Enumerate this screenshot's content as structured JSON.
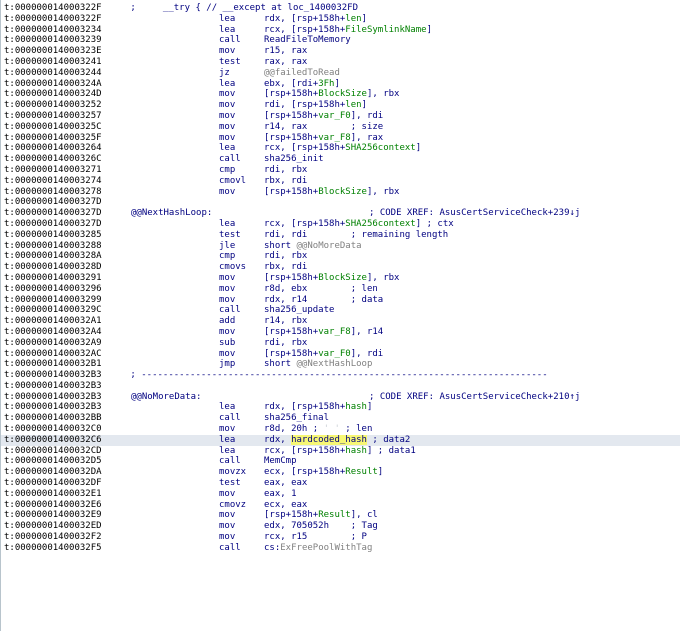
{
  "rows": [
    {
      "addr": "t:000000014000322F",
      "parts": [
        {
          "t": " ;     __try { // __except at loc_1400032FD",
          "k": "cm"
        }
      ],
      "full": true
    },
    {
      "addr": "t:000000014000322F",
      "mn": "lea",
      "ops": [
        {
          "t": "rdx, [rsp+158h+"
        },
        {
          "t": "len",
          "k": "gr"
        },
        {
          "t": "]"
        }
      ]
    },
    {
      "addr": "t:0000000140003234",
      "mn": "lea",
      "ops": [
        {
          "t": "rcx, [rsp+158h+"
        },
        {
          "t": "FileSymlinkName",
          "k": "gr"
        },
        {
          "t": "]"
        }
      ]
    },
    {
      "addr": "t:0000000140003239",
      "mn": "call",
      "ops": [
        {
          "t": "ReadFileToMemory"
        }
      ]
    },
    {
      "addr": "t:000000014000323E",
      "mn": "mov",
      "ops": [
        {
          "t": "r15, rax"
        }
      ]
    },
    {
      "addr": "t:0000000140003241",
      "mn": "test",
      "ops": [
        {
          "t": "rax, rax"
        }
      ]
    },
    {
      "addr": "t:0000000140003244",
      "mn": "jz",
      "ops": [
        {
          "t": "@@failedToRead",
          "k": "gy"
        }
      ]
    },
    {
      "addr": "t:000000014000324A",
      "mn": "lea",
      "ops": [
        {
          "t": "ebx, [rdi+"
        },
        {
          "t": "3Fh",
          "k": "gr"
        },
        {
          "t": "]"
        }
      ]
    },
    {
      "addr": "t:000000014000324D",
      "mn": "mov",
      "ops": [
        {
          "t": "[rsp+158h+"
        },
        {
          "t": "BlockSize",
          "k": "gr"
        },
        {
          "t": "], rbx"
        }
      ]
    },
    {
      "addr": "t:0000000140003252",
      "mn": "mov",
      "ops": [
        {
          "t": "rdi, [rsp+158h+"
        },
        {
          "t": "len",
          "k": "gr"
        },
        {
          "t": "]"
        }
      ]
    },
    {
      "addr": "t:0000000140003257",
      "mn": "mov",
      "ops": [
        {
          "t": "[rsp+158h+"
        },
        {
          "t": "var_F0",
          "k": "gr"
        },
        {
          "t": "], rdi"
        }
      ]
    },
    {
      "addr": "t:000000014000325C",
      "mn": "mov",
      "ops": [
        {
          "t": "r14, rax        ; size"
        }
      ]
    },
    {
      "addr": "t:000000014000325F",
      "mn": "mov",
      "ops": [
        {
          "t": "[rsp+158h+"
        },
        {
          "t": "var_F8",
          "k": "gr"
        },
        {
          "t": "], rax"
        }
      ]
    },
    {
      "addr": "t:0000000140003264",
      "mn": "lea",
      "ops": [
        {
          "t": "rcx, [rsp+158h+"
        },
        {
          "t": "SHA256context",
          "k": "gr"
        },
        {
          "t": "]"
        }
      ]
    },
    {
      "addr": "t:000000014000326C",
      "mn": "call",
      "ops": [
        {
          "t": "sha256_init"
        }
      ]
    },
    {
      "addr": "t:0000000140003271",
      "mn": "cmp",
      "ops": [
        {
          "t": "rdi, rbx"
        }
      ]
    },
    {
      "addr": "t:0000000140003274",
      "mn": "cmovl",
      "ops": [
        {
          "t": "rbx, rdi"
        }
      ]
    },
    {
      "addr": "t:0000000140003278",
      "mn": "mov",
      "ops": [
        {
          "t": "[rsp+158h+"
        },
        {
          "t": "BlockSize",
          "k": "gr"
        },
        {
          "t": "], rbx"
        }
      ]
    },
    {
      "addr": "t:000000014000327D"
    },
    {
      "addr": "t:000000014000327D",
      "label": "@@NextHashLoop:",
      "comment": "; CODE XREF: AsusCertServiceCheck+239↓j"
    },
    {
      "addr": "t:000000014000327D",
      "mn": "lea",
      "ops": [
        {
          "t": "rcx, [rsp+158h+"
        },
        {
          "t": "SHA256context",
          "k": "gr"
        },
        {
          "t": "] ; ctx"
        }
      ]
    },
    {
      "addr": "t:0000000140003285",
      "mn": "test",
      "ops": [
        {
          "t": "rdi, rdi        ; remaining length"
        }
      ]
    },
    {
      "addr": "t:0000000140003288",
      "mn": "jle",
      "ops": [
        {
          "t": "short "
        },
        {
          "t": "@@NoMoreData",
          "k": "gy"
        }
      ]
    },
    {
      "addr": "t:000000014000328A",
      "mn": "cmp",
      "ops": [
        {
          "t": "rdi, rbx"
        }
      ]
    },
    {
      "addr": "t:000000014000328D",
      "mn": "cmovs",
      "ops": [
        {
          "t": "rbx, rdi"
        }
      ]
    },
    {
      "addr": "t:0000000140003291",
      "mn": "mov",
      "ops": [
        {
          "t": "[rsp+158h+"
        },
        {
          "t": "BlockSize",
          "k": "gr"
        },
        {
          "t": "], rbx"
        }
      ]
    },
    {
      "addr": "t:0000000140003296",
      "mn": "mov",
      "ops": [
        {
          "t": "r8d, ebx        ; len"
        }
      ]
    },
    {
      "addr": "t:0000000140003299",
      "mn": "mov",
      "ops": [
        {
          "t": "rdx, r14        ; data"
        }
      ]
    },
    {
      "addr": "t:000000014000329C",
      "mn": "call",
      "ops": [
        {
          "t": "sha256_update"
        }
      ]
    },
    {
      "addr": "t:00000001400032A1",
      "mn": "add",
      "ops": [
        {
          "t": "r14, rbx"
        }
      ]
    },
    {
      "addr": "t:00000001400032A4",
      "mn": "mov",
      "ops": [
        {
          "t": "[rsp+158h+"
        },
        {
          "t": "var_F8",
          "k": "gr"
        },
        {
          "t": "], r14"
        }
      ]
    },
    {
      "addr": "t:00000001400032A9",
      "mn": "sub",
      "ops": [
        {
          "t": "rdi, rbx"
        }
      ]
    },
    {
      "addr": "t:00000001400032AC",
      "mn": "mov",
      "ops": [
        {
          "t": "[rsp+158h+"
        },
        {
          "t": "var_F0",
          "k": "gr"
        },
        {
          "t": "], rdi"
        }
      ]
    },
    {
      "addr": "t:00000001400032B1",
      "mn": "jmp",
      "ops": [
        {
          "t": "short "
        },
        {
          "t": "@@NextHashLoop",
          "k": "gy"
        }
      ]
    },
    {
      "addr": "t:00000001400032B3",
      "parts": [
        {
          "t": " ; ---------------------------------------------------------------------------",
          "k": "cm"
        }
      ],
      "full": true
    },
    {
      "addr": "t:00000001400032B3"
    },
    {
      "addr": "t:00000001400032B3",
      "label": "@@NoMoreData:",
      "comment": "; CODE XREF: AsusCertServiceCheck+210↑j"
    },
    {
      "addr": "t:00000001400032B3",
      "mn": "lea",
      "ops": [
        {
          "t": "rdx, [rsp+158h+"
        },
        {
          "t": "hash",
          "k": "gr"
        },
        {
          "t": "]"
        }
      ]
    },
    {
      "addr": "t:00000001400032BB",
      "mn": "call",
      "ops": [
        {
          "t": "sha256_final"
        }
      ]
    },
    {
      "addr": "t:00000001400032C0",
      "mn": "mov",
      "ops": [
        {
          "t": "r8d, 20h ; "
        },
        {
          "t": "' '",
          "k": "ghost"
        },
        {
          "t": " ; len"
        }
      ]
    },
    {
      "addr": "t:00000001400032C6",
      "mn": "lea",
      "ops": [
        {
          "t": "rdx, "
        },
        {
          "t": "hardcoded_hash",
          "k": "hlw"
        },
        {
          "t": " ; data2"
        }
      ],
      "hl": true
    },
    {
      "addr": "t:00000001400032CD",
      "mn": "lea",
      "ops": [
        {
          "t": "rcx, [rsp+158h+"
        },
        {
          "t": "hash",
          "k": "gr"
        },
        {
          "t": "] ; data1"
        }
      ]
    },
    {
      "addr": "t:00000001400032D5",
      "mn": "call",
      "ops": [
        {
          "t": "MemCmp"
        }
      ]
    },
    {
      "addr": "t:00000001400032DA",
      "mn": "movzx",
      "ops": [
        {
          "t": "ecx, [rsp+158h+"
        },
        {
          "t": "Result",
          "k": "gr"
        },
        {
          "t": "]"
        }
      ]
    },
    {
      "addr": "t:00000001400032DF",
      "mn": "test",
      "ops": [
        {
          "t": "eax, eax"
        }
      ]
    },
    {
      "addr": "t:00000001400032E1",
      "mn": "mov",
      "ops": [
        {
          "t": "eax, 1"
        }
      ]
    },
    {
      "addr": "t:00000001400032E6",
      "mn": "cmovz",
      "ops": [
        {
          "t": "ecx, eax"
        }
      ]
    },
    {
      "addr": "t:00000001400032E9",
      "mn": "mov",
      "ops": [
        {
          "t": "[rsp+158h+"
        },
        {
          "t": "Result",
          "k": "gr"
        },
        {
          "t": "], cl"
        }
      ]
    },
    {
      "addr": "t:00000001400032ED",
      "mn": "mov",
      "ops": [
        {
          "t": "edx, 705052h    ; Tag"
        }
      ]
    },
    {
      "addr": "t:00000001400032F2",
      "mn": "mov",
      "ops": [
        {
          "t": "rcx, r15        ; P"
        }
      ]
    },
    {
      "addr": "t:00000001400032F5",
      "mn": "call",
      "ops": [
        {
          "t": "cs:"
        },
        {
          "t": "ExFreePoolWithTag",
          "k": "gy"
        }
      ]
    }
  ],
  "colors": {
    "background": "#ffffff",
    "address": "#000000",
    "code": "#000080",
    "stack_var": "#008000",
    "label_ref": "#808080",
    "highlight_line": "#e3e8ef",
    "highlight_word": "#f7f775"
  }
}
